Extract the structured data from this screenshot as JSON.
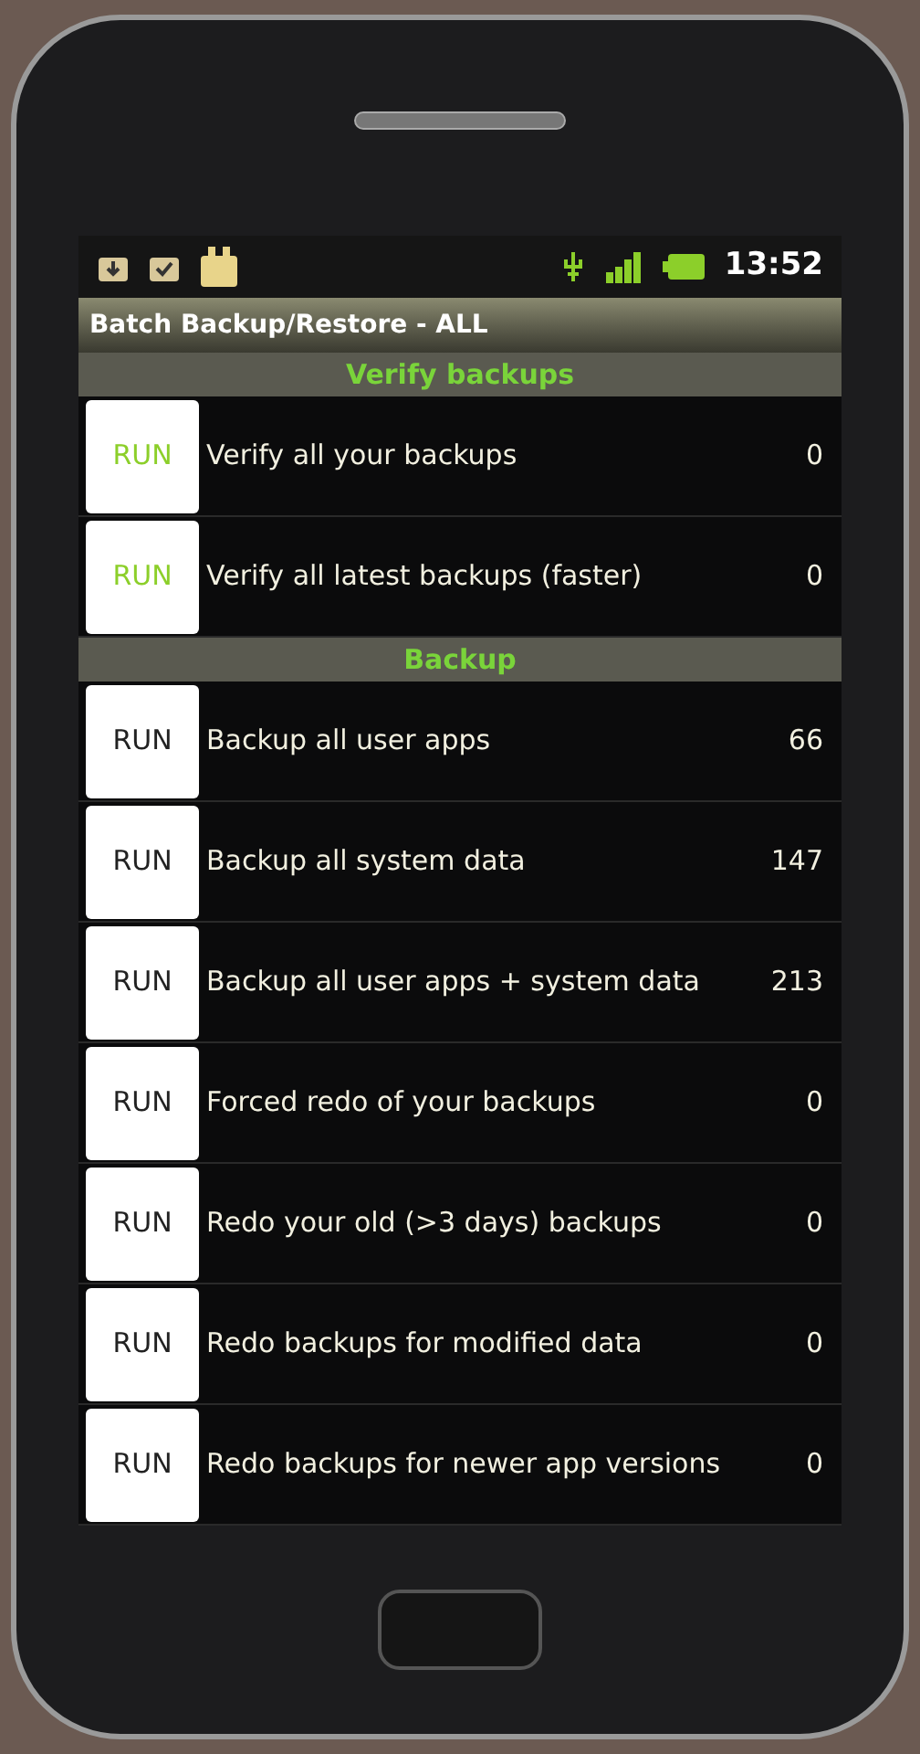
{
  "status_bar": {
    "time": "13:52"
  },
  "title": "Batch Backup/Restore - ALL",
  "sections": [
    {
      "header": "Verify backups",
      "kind": "verify",
      "items": [
        {
          "button": "RUN",
          "label": "Verify all your backups",
          "count": "0"
        },
        {
          "button": "RUN",
          "label": "Verify all latest backups (faster)",
          "count": "0"
        }
      ]
    },
    {
      "header": "Backup",
      "kind": "backup",
      "items": [
        {
          "button": "RUN",
          "label": "Backup all user apps",
          "count": "66"
        },
        {
          "button": "RUN",
          "label": "Backup all system data",
          "count": "147"
        },
        {
          "button": "RUN",
          "label": "Backup all user apps + system data",
          "count": "213"
        },
        {
          "button": "RUN",
          "label": "Forced redo of your backups",
          "count": "0"
        },
        {
          "button": "RUN",
          "label": "Redo your old (>3 days) backups",
          "count": "0"
        },
        {
          "button": "RUN",
          "label": "Redo backups for modified data",
          "count": "0"
        },
        {
          "button": "RUN",
          "label": "Redo backups for newer app versions",
          "count": "0"
        }
      ]
    }
  ]
}
